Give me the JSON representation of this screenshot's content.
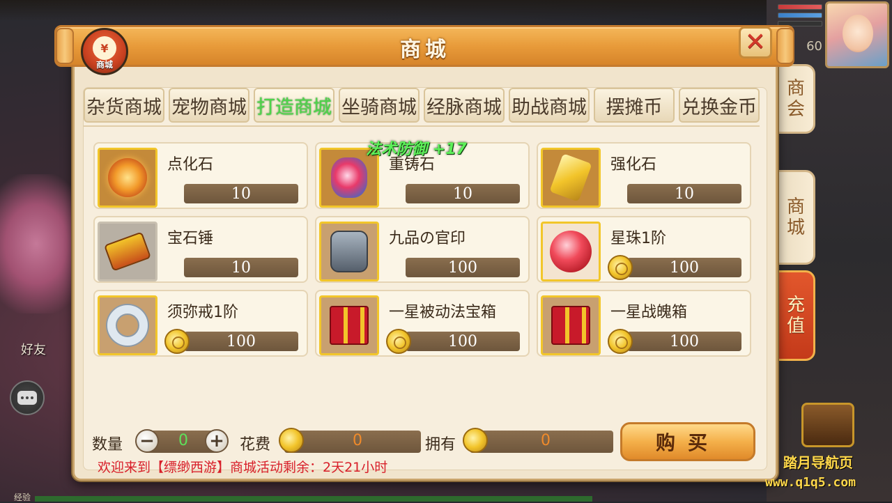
{
  "window": {
    "title": "商城",
    "logo_label": "商城",
    "logo_symbol": "¥",
    "close_symbol": "✕"
  },
  "hud": {
    "level": "60"
  },
  "side_tabs": [
    "商会",
    "商城",
    "充值"
  ],
  "categories": [
    {
      "label": "杂货商城",
      "active": false
    },
    {
      "label": "宠物商城",
      "active": false
    },
    {
      "label": "打造商城",
      "active": true
    },
    {
      "label": "坐骑商城",
      "active": false
    },
    {
      "label": "经脉商城",
      "active": false
    },
    {
      "label": "助战商城",
      "active": false
    },
    {
      "label": "摆摊币",
      "active": false
    },
    {
      "label": "兑换金币",
      "active": false
    }
  ],
  "items": [
    {
      "name": "点化石",
      "price": "10",
      "coin": false,
      "icon": "swirl-stone-icon"
    },
    {
      "name": "重铸石",
      "price": "10",
      "coin": false,
      "icon": "reforge-stone-icon"
    },
    {
      "name": "强化石",
      "price": "10",
      "coin": false,
      "icon": "gold-bar-icon"
    },
    {
      "name": "宝石锤",
      "price": "10",
      "coin": false,
      "icon": "gem-hammer-icon"
    },
    {
      "name": "九品の官印",
      "price": "100",
      "coin": false,
      "icon": "official-seal-icon"
    },
    {
      "name": "星珠1阶",
      "price": "100",
      "coin": true,
      "icon": "red-orb-icon"
    },
    {
      "name": "须弥戒1阶",
      "price": "100",
      "coin": true,
      "icon": "silver-ring-icon"
    },
    {
      "name": "一星被动法宝箱",
      "price": "100",
      "coin": true,
      "icon": "gift-box-icon"
    },
    {
      "name": "一星战魄箱",
      "price": "100",
      "coin": true,
      "icon": "gift-box-icon"
    }
  ],
  "float_text": "法术防御 +17",
  "bottom": {
    "qty_label": "数量",
    "qty_value": "0",
    "minus": "−",
    "plus": "+",
    "cost_label": "花费",
    "cost_value": "0",
    "own_label": "拥有",
    "own_value": "0",
    "buy_label": "购买",
    "notice": "欢迎来到【缥缈西游】商城活动剩余：2天21小时"
  },
  "left_hud": {
    "friend": "好友",
    "exp": "经验"
  },
  "watermark": {
    "line1": "踏月导航页",
    "line2": "www.q1q5.com"
  },
  "colors": {
    "accent": "#e89b3a",
    "active_tab": "#4ed44a",
    "price_bar": "#6e563c",
    "notice": "#d8202a"
  }
}
